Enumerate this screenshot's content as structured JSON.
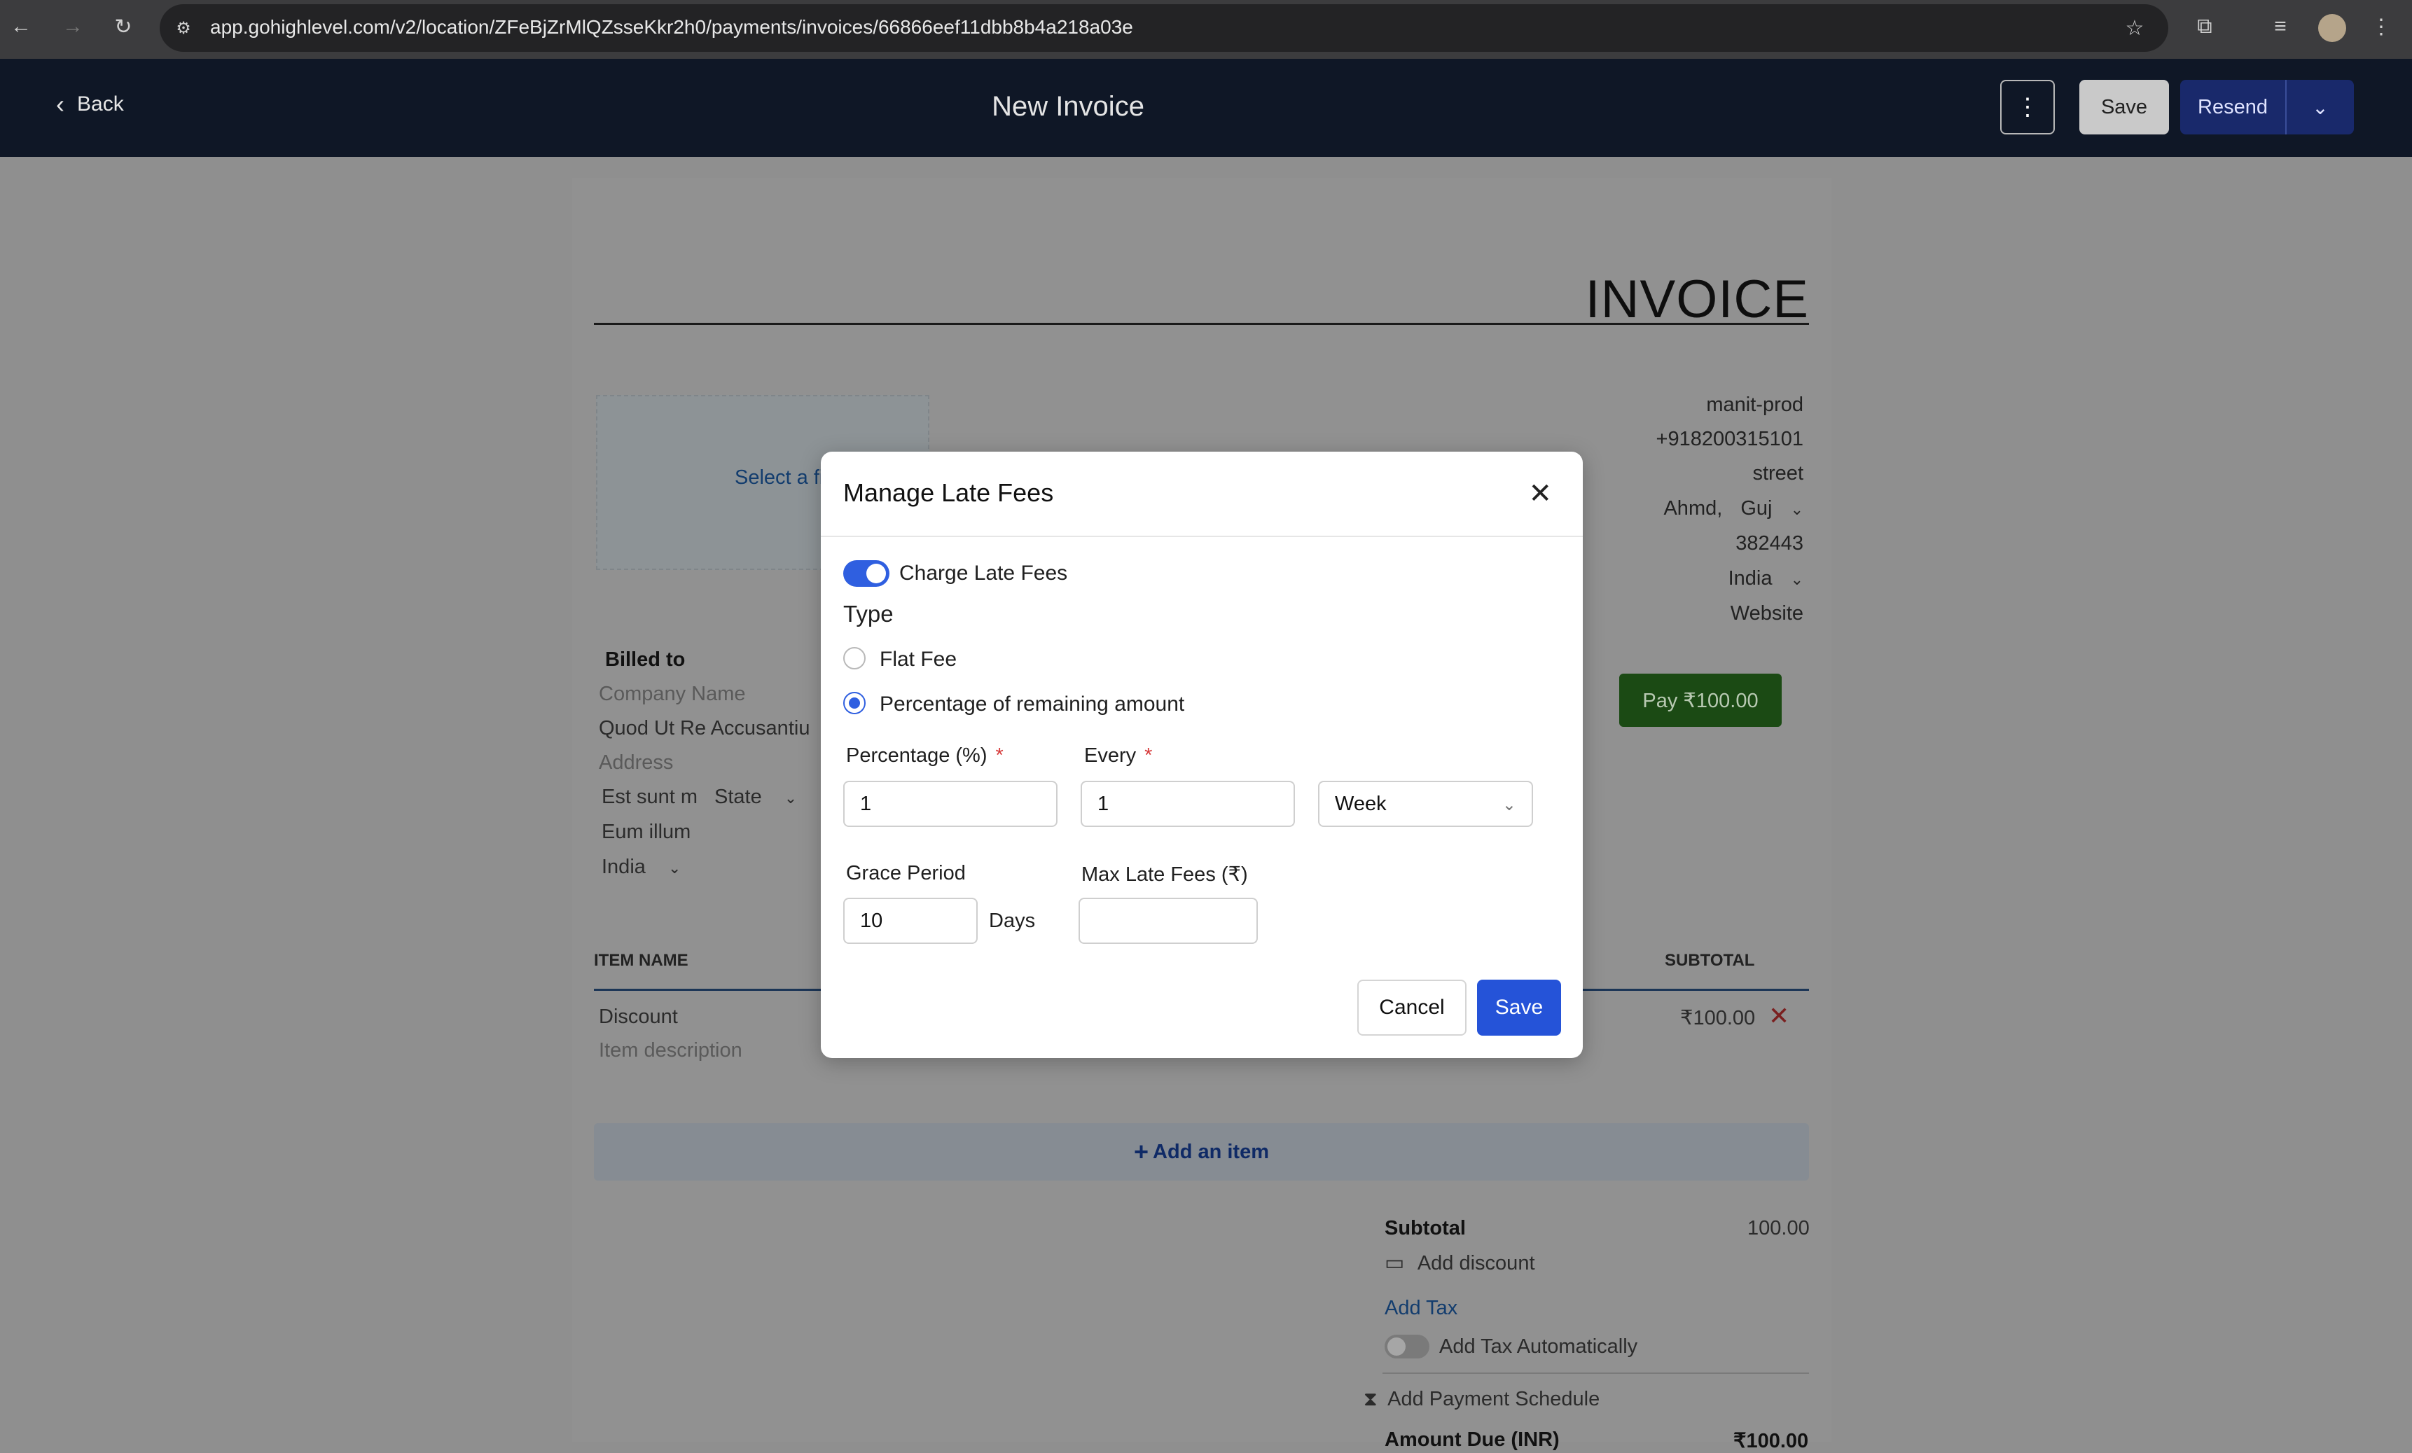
{
  "browser": {
    "url": "app.gohighlevel.com/v2/location/ZFeBjZrMlQZsseKkr2h0/payments/invoices/66866eef11dbb8b4a218a03e"
  },
  "header": {
    "back_label": "Back",
    "title": "New Invoice",
    "save_label": "Save",
    "resend_label": "Resend"
  },
  "invoice": {
    "heading": "INVOICE",
    "select_file": "Select a file",
    "business": {
      "name": "manit-prod",
      "phone": "+918200315101",
      "street": "street",
      "city": "Ahmd,",
      "state": "Guj",
      "zip": "382443",
      "country": "India",
      "website_placeholder": "Website"
    },
    "pay_button": "Pay ₹100.00",
    "billed_to": {
      "label": "Billed to",
      "company_placeholder": "Company Name",
      "company": "Quod Ut Re Accusantiu",
      "address_placeholder": "Address",
      "city": "Est sunt m",
      "state": "State",
      "line3": "Eum illum",
      "country": "India"
    },
    "table": {
      "col_item": "ITEM NAME",
      "col_subtotal": "SUBTOTAL",
      "row": {
        "name": "Discount",
        "description_placeholder": "Item description",
        "subtotal": "₹100.00"
      },
      "add_item": "Add an item"
    },
    "totals": {
      "subtotal_label": "Subtotal",
      "subtotal_value": "100.00",
      "add_discount": "Add discount",
      "add_tax": "Add Tax",
      "add_tax_auto": "Add Tax Automatically",
      "add_schedule": "Add Payment Schedule",
      "amount_due_label": "Amount Due (INR)",
      "amount_due_value": "₹100.00"
    }
  },
  "modal": {
    "title": "Manage Late Fees",
    "charge_label": "Charge Late Fees",
    "charge_enabled": true,
    "type_label": "Type",
    "option_flat": "Flat Fee",
    "option_percentage": "Percentage of remaining amount",
    "selected_option": "Percentage of remaining amount",
    "percentage_label": "Percentage (%)",
    "percentage_value": "1",
    "every_label": "Every",
    "every_value": "1",
    "every_unit": "Week",
    "grace_label": "Grace Period",
    "grace_value": "10",
    "grace_unit": "Days",
    "max_label": "Max Late Fees (₹)",
    "max_value": "",
    "required_mark": "*",
    "cancel_label": "Cancel",
    "save_label": "Save"
  }
}
